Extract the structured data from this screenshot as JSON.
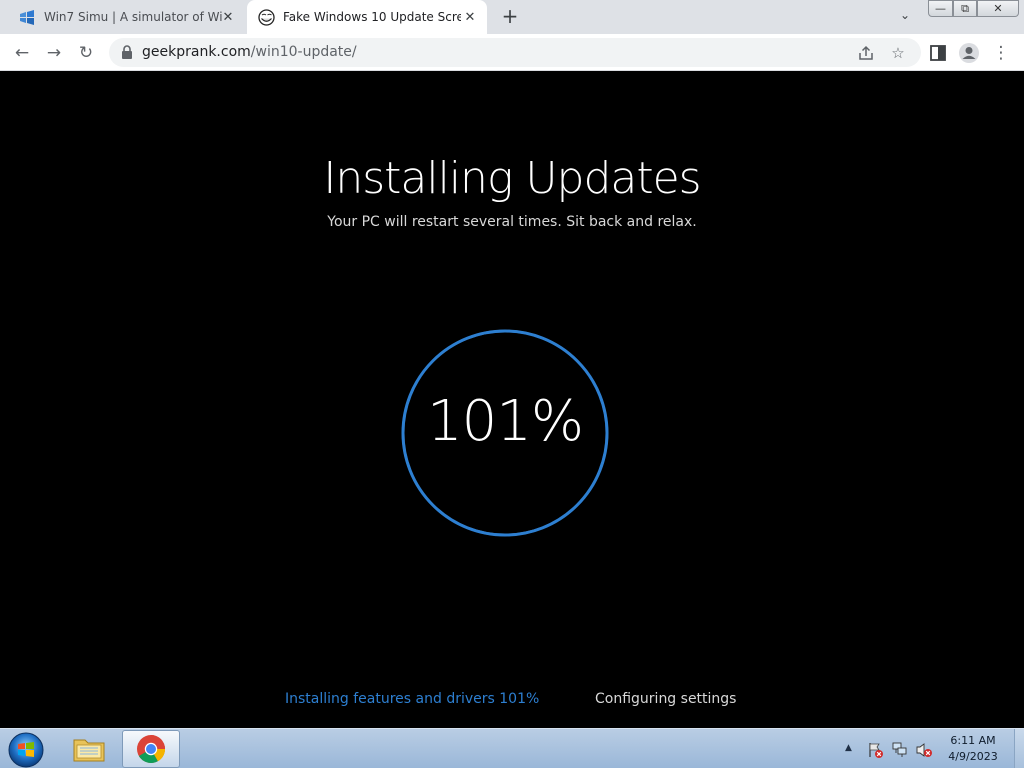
{
  "tabs": [
    {
      "title": "Win7 Simu | A simulator of Windows 7",
      "active": false
    },
    {
      "title": "Fake Windows 10 Update Screen",
      "active": true
    }
  ],
  "window_controls": {
    "minimize": "—",
    "maximize": "⧉",
    "close": "✕"
  },
  "toolbar": {
    "back": "←",
    "forward": "→",
    "reload": "↻",
    "url_host": "geekprank.com",
    "url_path": "/win10-update/",
    "menu": "⋮"
  },
  "page": {
    "title": "Installing Updates",
    "subtitle": "Your PC will restart several times. Sit back and relax.",
    "percent": "101%",
    "progress_fraction": 1.01,
    "status_left": "Installing features and drivers 101%",
    "status_right": "Configuring settings",
    "accent_color": "#2d7fd1",
    "ring_track_color": "#808080"
  },
  "taskbar": {
    "time": "6:11 AM",
    "date": "4/9/2023"
  }
}
